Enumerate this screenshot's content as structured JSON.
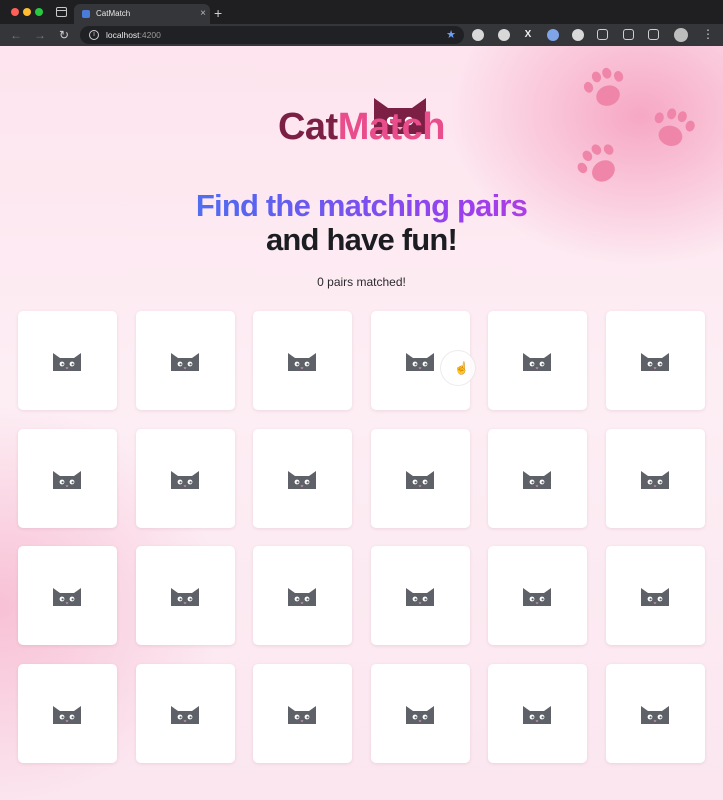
{
  "browser": {
    "tab_title": "CatMatch",
    "tab_close": "×",
    "new_tab": "+",
    "url_host": "localhost",
    "url_port": ":4200",
    "back": "←",
    "forward": "→",
    "reload": "↻",
    "info": "i",
    "star": "★",
    "extension_x": "X",
    "menu": "⋮"
  },
  "header": {
    "logo_part1": "Cat",
    "logo_part2": "Match",
    "headline_line1": "Find the matching pairs",
    "headline_line2": "and have fun!"
  },
  "game": {
    "status": "0 pairs matched!",
    "rows": 4,
    "columns": 6,
    "card_back_icon": "cat-face-icon"
  },
  "colors": {
    "logo_dark": "#7c1f44",
    "logo_pink": "#e94d8c",
    "headline_gradient": [
      "#2f9bf0",
      "#5a62f0",
      "#9b3fee",
      "#e93bc5"
    ],
    "cat_icon": "#5e6268",
    "paw": "#ef86a9"
  }
}
